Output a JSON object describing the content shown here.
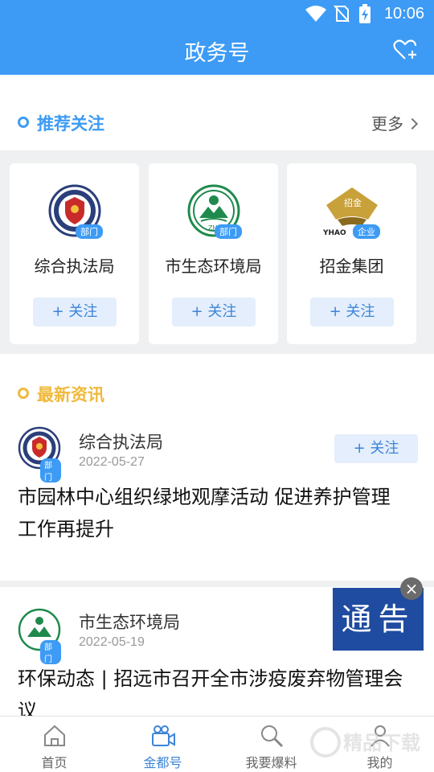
{
  "status_bar": {
    "time": "10:06"
  },
  "header": {
    "title": "政务号"
  },
  "recommended": {
    "title": "推荐关注",
    "more_label": "更多",
    "accent": "#3d9bf5",
    "cards": [
      {
        "name": "综合执法局",
        "badge": "部门",
        "follow_label": "+ 关注",
        "logo_icon": "law-enforcement-emblem-icon"
      },
      {
        "name": "市生态环境局",
        "badge": "部门",
        "follow_label": "+ 关注",
        "logo_icon": "ecology-emblem-icon",
        "logo_text": "ZH"
      },
      {
        "name": "招金集团",
        "badge": "企业",
        "follow_label": "+ 关注",
        "logo_icon": "gold-group-logo-icon",
        "logo_text": "招金",
        "logo_subtext": "YHAO"
      }
    ]
  },
  "latest": {
    "title": "最新资讯",
    "accent": "#f0b93a",
    "items": [
      {
        "source": "综合执法局",
        "badge": "部门",
        "date": "2022-05-27",
        "follow_label": "+ 关注",
        "headline": "市园林中心组织绿地观摩活动 促进养护管理工作再提升"
      },
      {
        "source": "市生态环境局",
        "badge": "部门",
        "date": "2022-05-19",
        "headline": "环保动态 | 招远市召开全市涉疫废弃物管理会议"
      }
    ]
  },
  "notice": {
    "text": "通告",
    "close": "×"
  },
  "bottom_nav": [
    {
      "label": "首页",
      "icon": "home-icon",
      "active": false
    },
    {
      "label": "金都号",
      "icon": "video-camera-icon",
      "active": true
    },
    {
      "label": "我要爆料",
      "icon": "search-report-icon",
      "active": false
    },
    {
      "label": "我的",
      "icon": "user-icon",
      "active": false
    }
  ],
  "watermark": {
    "text": "精品下载"
  }
}
